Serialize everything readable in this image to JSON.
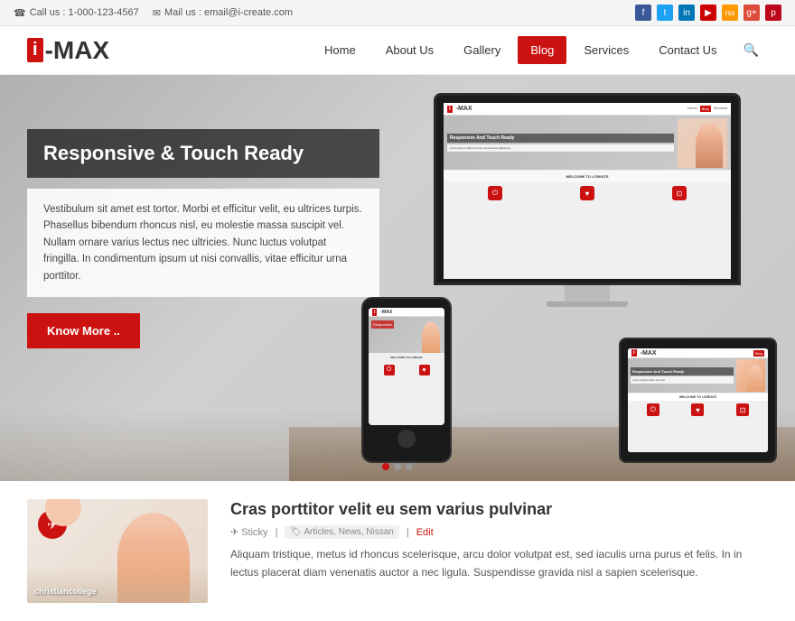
{
  "topbar": {
    "phone_icon": "☎",
    "phone_label": "Call us : 1-000-123-4567",
    "mail_icon": "✉",
    "mail_label": "Mail us : email@i-create.com",
    "social_icons": [
      {
        "id": "fb",
        "label": "f",
        "color": "#3b5998"
      },
      {
        "id": "tw",
        "label": "t",
        "color": "#1da1f2"
      },
      {
        "id": "li",
        "label": "in",
        "color": "#0077b5"
      },
      {
        "id": "yt",
        "label": "▶",
        "color": "#cc0000"
      },
      {
        "id": "rss",
        "label": "rss",
        "color": "#f90"
      },
      {
        "id": "g",
        "label": "g+",
        "color": "#dd4b39"
      },
      {
        "id": "pi",
        "label": "p",
        "color": "#bd081c"
      }
    ]
  },
  "header": {
    "logo_i": "i",
    "logo_name": "-MAX",
    "nav": [
      {
        "label": "Home",
        "active": false
      },
      {
        "label": "About Us",
        "active": false
      },
      {
        "label": "Gallery",
        "active": false
      },
      {
        "label": "Blog",
        "active": true
      },
      {
        "label": "Services",
        "active": false
      },
      {
        "label": "Contact Us",
        "active": false
      }
    ]
  },
  "hero": {
    "title": "Responsive & Touch Ready",
    "description": "Vestibulum sit amet est tortor. Morbi et efficitur velit, eu ultrices turpis. Phasellus bibendum rhoncus nisl, eu molestie massa suscipit vel. Nullam ornare varius lectus nec ultricies. Nunc luctus volutpat fringilla. In condimentum ipsum ut nisi convallis, vitae efficitur urna porttitor.",
    "cta_label": "Know More ..",
    "dots": [
      "active",
      "",
      ""
    ]
  },
  "mini_site": {
    "logo_i": "i",
    "logo_text": "-MAX",
    "hero_title": "Responsive And Touch Ready",
    "welcome_text": "WELCOME TO I-CREATE",
    "icons": [
      {
        "color": "#cc1111",
        "symbol": "⏻"
      },
      {
        "color": "#cc1111",
        "symbol": "♥"
      },
      {
        "color": "#cc1111",
        "symbol": "⊡"
      }
    ]
  },
  "blog_post": {
    "title": "Cras porttitor velit eu sem varius pulvinar",
    "sticky_icon": "✈",
    "sticky_label": "Sticky",
    "tags_label": "Articles, News, Nissan",
    "edit_label": "Edit",
    "description": "Aliquam tristique, metus id rhoncus scelerisque, arcu dolor volutpat est, sed iaculis urna purus et felis. In in lectus placerat diam venenatis auctor a nec ligula. Suspendisse gravida nisl a sapien scelerisque."
  }
}
